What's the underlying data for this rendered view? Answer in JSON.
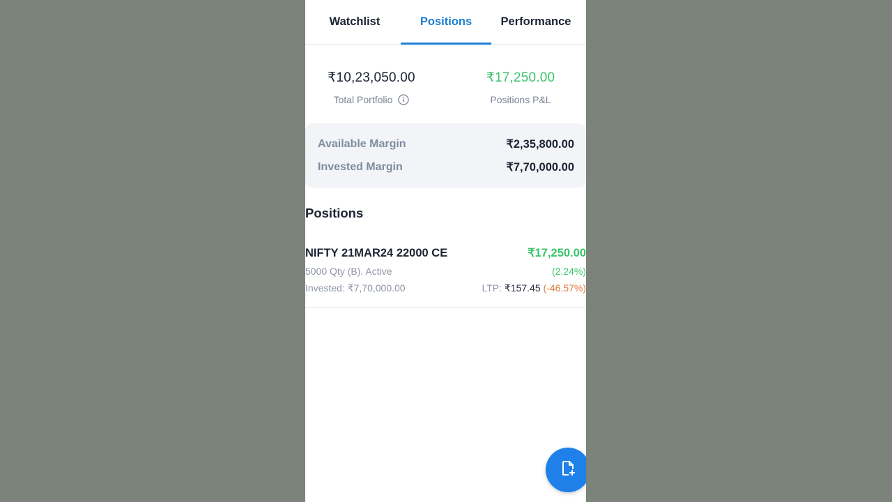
{
  "tabs": [
    {
      "label": "Watchlist",
      "active": false
    },
    {
      "label": "Positions",
      "active": true
    },
    {
      "label": "Performance",
      "active": false
    }
  ],
  "summary": {
    "total_portfolio_value": "₹10,23,050.00",
    "total_portfolio_label": "Total Portfolio",
    "positions_pnl_value": "₹17,250.00",
    "positions_pnl_label": "Positions P&L"
  },
  "margins": {
    "available_label": "Available Margin",
    "available_value": "₹2,35,800.00",
    "invested_label": "Invested Margin",
    "invested_value": "₹7,70,000.00"
  },
  "positions_title": "Positions",
  "positions": [
    {
      "name": "NIFTY 21MAR24 22000 CE",
      "pnl": "₹17,250.00",
      "qty_status": "5000 Qty (B). Active",
      "pnl_pct": "(2.24%)",
      "invested": "Invested: ₹7,70,000.00",
      "ltp_label": "LTP:",
      "ltp_value": "₹157.45",
      "ltp_change": "(-46.57%)"
    }
  ],
  "colors": {
    "accent": "#1d7fd4",
    "profit": "#3cc46b",
    "loss": "#e07a3c",
    "fab": "#1e80e8"
  },
  "icons": {
    "info": "info-icon",
    "fab": "add-document-icon"
  }
}
